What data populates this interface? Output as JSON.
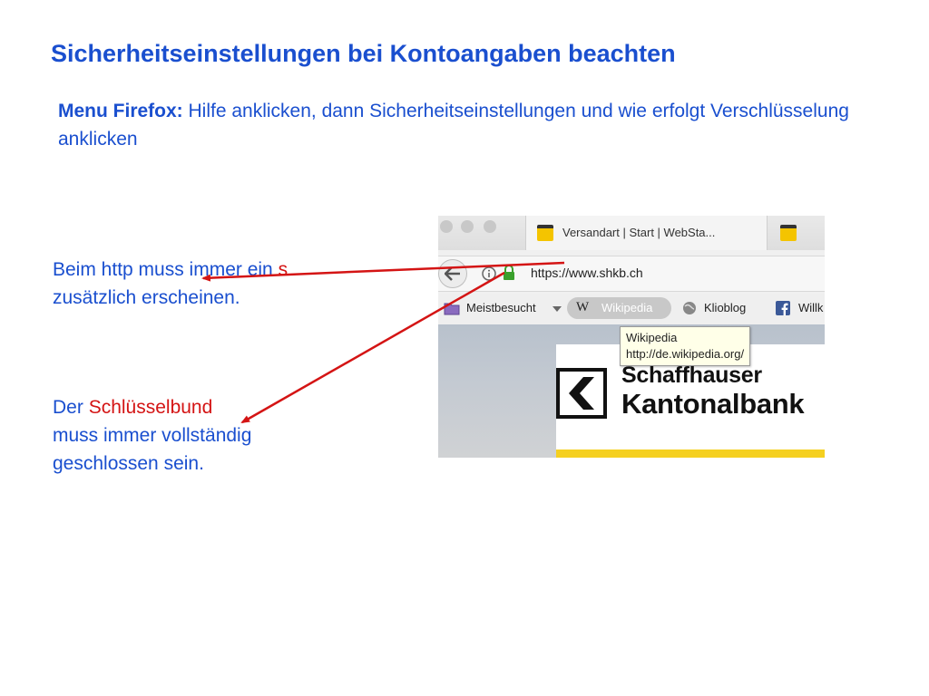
{
  "title": "Sicherheitseinstellungen bei Kontoangaben beachten",
  "intro": {
    "label": "Menu Firefox:",
    "text": " Hilfe anklicken, dann Sicherheitseinstellungen und wie erfolgt Verschlüsselung anklicken"
  },
  "note_https": {
    "before": "Beim http muss immer ein ",
    "highlight": "s",
    "after": " zusätzlich erscheinen."
  },
  "note_lock": {
    "before": "Der ",
    "highlight": "Schlüsselbund",
    "after": " muss immer vollständig geschlossen sein."
  },
  "browser": {
    "tab_title": "Versandart | Start | WebSta...",
    "tab_close": "×",
    "url": "https://www.shkb.ch",
    "bookmarks": {
      "most_visited": "Meistbesucht",
      "wikipedia": "Wikipedia",
      "klioblog": "Klioblog",
      "cut": "Willk"
    },
    "tooltip": {
      "line1": "Wikipedia",
      "line2": "http://de.wikipedia.org/"
    },
    "bank": {
      "line1": "Schaffhauser",
      "line2": "Kantonalbank"
    }
  },
  "colors": {
    "text_blue": "#1a4fcf",
    "highlight_red": "#d41414",
    "arrow_red": "#d41414",
    "bank_yellow": "#f5d020"
  }
}
